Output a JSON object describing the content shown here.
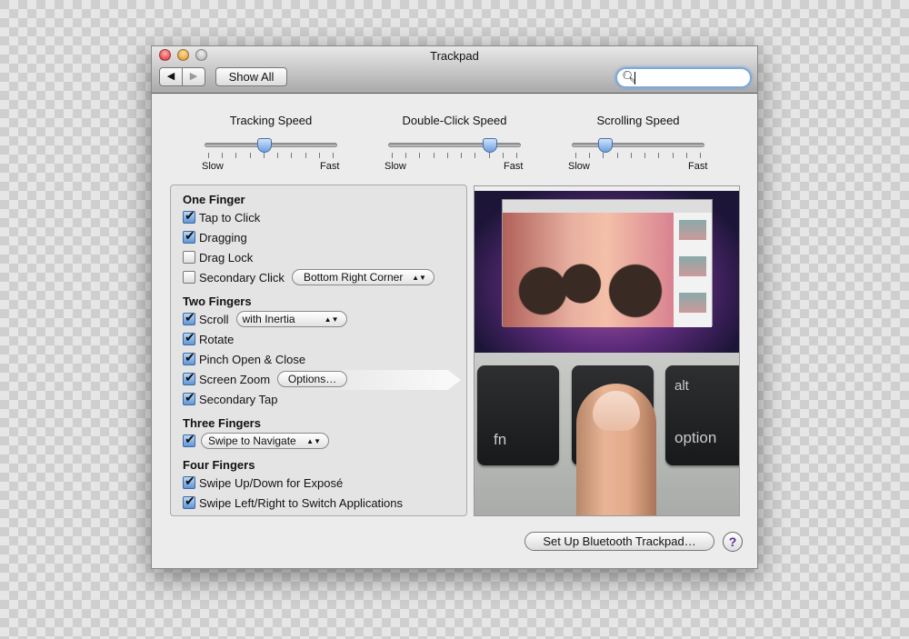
{
  "window": {
    "title": "Trackpad"
  },
  "toolbar": {
    "back_icon": "back-arrow-icon",
    "forward_icon": "forward-arrow-icon",
    "show_all": "Show All",
    "search_value": "",
    "search_icon": "magnifier-icon"
  },
  "sliders": [
    {
      "label": "Tracking Speed",
      "min_label": "Slow",
      "max_label": "Fast",
      "value": 0.45
    },
    {
      "label": "Double-Click Speed",
      "min_label": "Slow",
      "max_label": "Fast",
      "value": 0.77
    },
    {
      "label": "Scrolling Speed",
      "min_label": "Slow",
      "max_label": "Fast",
      "value": 0.25
    }
  ],
  "sections": {
    "one_finger": {
      "title": "One Finger",
      "tap_to_click": "Tap to Click",
      "dragging": "Dragging",
      "drag_lock": "Drag Lock",
      "secondary_click": "Secondary Click",
      "secondary_click_option": "Bottom Right Corner"
    },
    "two_fingers": {
      "title": "Two Fingers",
      "scroll": "Scroll",
      "scroll_option": "with Inertia",
      "rotate": "Rotate",
      "pinch": "Pinch Open & Close",
      "screen_zoom": "Screen Zoom",
      "options_button": "Options…",
      "secondary_tap": "Secondary Tap"
    },
    "three_fingers": {
      "title": "Three Fingers",
      "option": "Swipe to Navigate"
    },
    "four_fingers": {
      "title": "Four Fingers",
      "expose": "Swipe Up/Down for Exposé",
      "switch_apps": "Swipe Left/Right to Switch Applications"
    }
  },
  "preview": {
    "key_fn": "fn",
    "key_alt": "alt",
    "key_option": "option"
  },
  "footer": {
    "bluetooth_button": "Set Up Bluetooth Trackpad…",
    "help": "?"
  }
}
